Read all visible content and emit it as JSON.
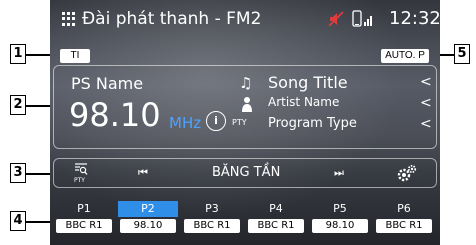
{
  "status_bar": {
    "title": "Đài phát thanh - FM2",
    "clock": "12:32",
    "icons": [
      "apps-grid-icon",
      "speaker-mute-icon",
      "phone-signal-icon"
    ]
  },
  "badges": {
    "ti": "TI",
    "auto_p": "AUTO. P"
  },
  "station_info": {
    "ps_name": "PS Name",
    "frequency": "98.10",
    "unit": "MHz",
    "info_button": "i",
    "pty": "PTY",
    "song_title": "Song Title",
    "artist_name": "Artist Name",
    "program_type": "Program Type",
    "chevron": "<"
  },
  "controls": {
    "search_pty_label": "PTY",
    "prev_icon": "⏮",
    "band_label": "BĂNG TẦN",
    "next_icon": "⏭"
  },
  "presets": [
    {
      "num": "P1",
      "value": "BBC R1",
      "active": false
    },
    {
      "num": "P2",
      "value": "98.10",
      "active": true
    },
    {
      "num": "P3",
      "value": "BBC R1",
      "active": false
    },
    {
      "num": "P4",
      "value": "BBC R1",
      "active": false
    },
    {
      "num": "P5",
      "value": "98.10",
      "active": false
    },
    {
      "num": "P6",
      "value": "BBC R1",
      "active": false
    }
  ],
  "callouts": {
    "c1": "1",
    "c2": "2",
    "c3": "3",
    "c4": "4",
    "c5": "5"
  },
  "colors": {
    "accent_blue": "#2f8fe8",
    "mhz_blue": "#4aa3ff",
    "mute_red": "#e23b3b"
  }
}
